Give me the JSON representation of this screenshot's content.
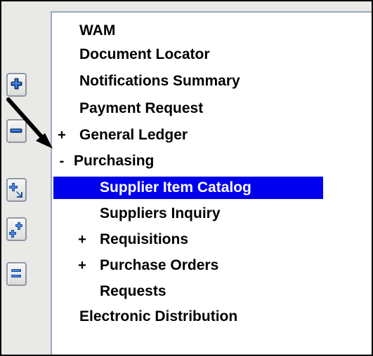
{
  "toolbar": {
    "expand_button_icon": "expand-icon",
    "collapse_button_icon": "collapse-icon",
    "expand_all_button_icon": "expand-all-icon",
    "expand_branch_button_icon": "expand-branch-icon",
    "collapse_all_button_icon": "collapse-all-icon"
  },
  "tree": {
    "items": [
      {
        "label": "WAM",
        "toggle": ""
      },
      {
        "label": "Document Locator",
        "toggle": ""
      },
      {
        "label": "Notifications Summary",
        "toggle": ""
      },
      {
        "label": "Payment Request",
        "toggle": ""
      },
      {
        "label": "General Ledger",
        "toggle": "+"
      },
      {
        "label": "Purchasing",
        "toggle": "-"
      },
      {
        "label": "Supplier Item Catalog",
        "toggle": "",
        "selected": true
      },
      {
        "label": "Suppliers Inquiry",
        "toggle": ""
      },
      {
        "label": "Requisitions",
        "toggle": "+"
      },
      {
        "label": "Purchase Orders",
        "toggle": "+"
      },
      {
        "label": "Requests",
        "toggle": ""
      },
      {
        "label": "Electronic Distribution",
        "toggle": ""
      }
    ]
  },
  "colors": {
    "selection": "#0000ef",
    "selection_text": "#ffffff",
    "text": "#000000",
    "panel_border": "#9aa7bf",
    "toolbar_background": "#e9e9e6"
  }
}
